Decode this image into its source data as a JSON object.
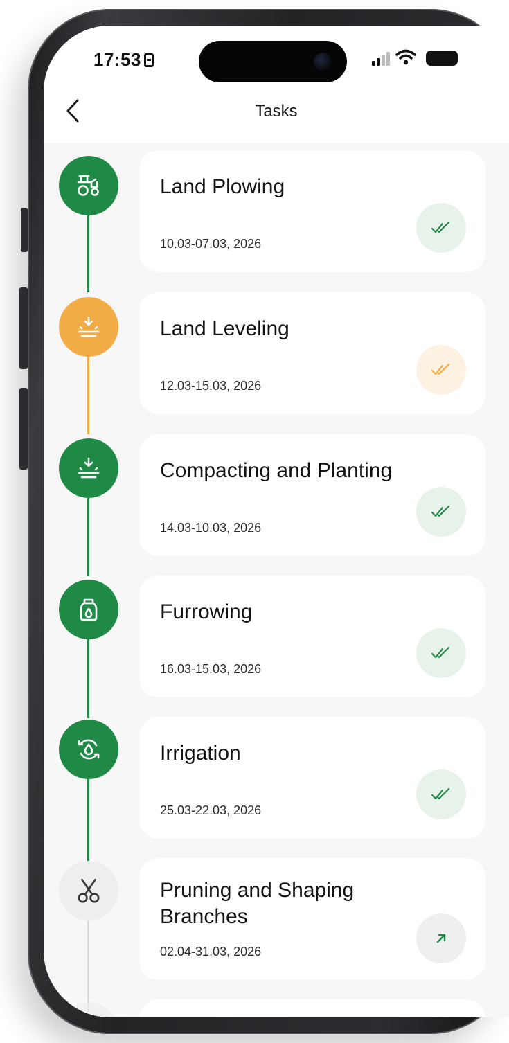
{
  "status_bar": {
    "time": "17:53"
  },
  "header": {
    "title": "Tasks",
    "back_icon": "chevron-left-icon"
  },
  "colors": {
    "done_green": "#1e8a45",
    "in_progress_orange": "#f2ac46",
    "pending_gray": "#eeeeee",
    "done_badge_bg": "#e7f2ea",
    "orange_badge_bg": "#fdf1e2",
    "pending_badge_bg": "#efefef"
  },
  "tasks": [
    {
      "title": "Land Plowing",
      "date": "10.03-07.03, 2026",
      "icon": "tractor-icon",
      "status": "done",
      "status_icon": "double-check-icon"
    },
    {
      "title": "Land Leveling",
      "date": "12.03-15.03, 2026",
      "icon": "sunrise-arrow-icon",
      "status": "in-progress",
      "status_icon": "double-check-icon"
    },
    {
      "title": "Compacting and Planting",
      "date": "14.03-10.03, 2026",
      "icon": "sunrise-arrow-icon",
      "status": "done",
      "status_icon": "double-check-icon"
    },
    {
      "title": "Furrowing",
      "date": "16.03-15.03, 2026",
      "icon": "fertilizer-bottle-icon",
      "status": "done",
      "status_icon": "double-check-icon"
    },
    {
      "title": "Irrigation",
      "date": "25.03-22.03, 2026",
      "icon": "water-cycle-icon",
      "status": "done",
      "status_icon": "double-check-icon"
    },
    {
      "title": "Pruning and Shaping Branches",
      "date": "02.04-31.03, 2026",
      "icon": "scissors-icon",
      "status": "pending",
      "status_icon": "arrow-up-right-icon"
    }
  ]
}
